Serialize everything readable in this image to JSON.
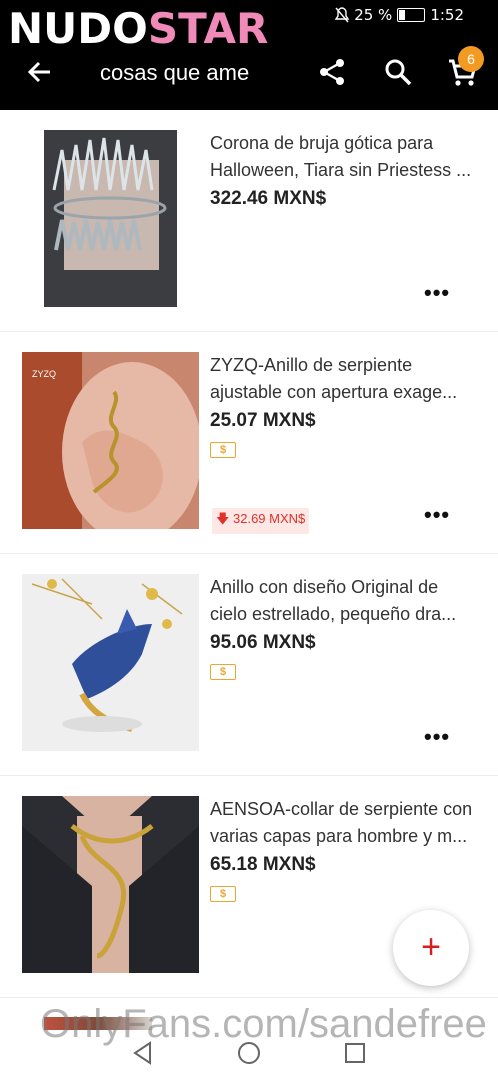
{
  "status_bar": {
    "battery": "25 %",
    "time": "1:52"
  },
  "watermark_logo": {
    "part1": "NUDO",
    "part2": "STAR"
  },
  "header": {
    "title": "cosas que ame",
    "cart_count": "6"
  },
  "items": [
    {
      "name_line1": "Corona de bruja gótica para",
      "name_line2": "Halloween, Tiara sin Priestess ...",
      "price": "322.46 MXN$",
      "has_tag": false,
      "old_price": ""
    },
    {
      "name_line1": "ZYZQ-Anillo de serpiente",
      "name_line2": "ajustable con apertura exage...",
      "price": "25.07 MXN$",
      "has_tag": true,
      "old_price": "32.69 MXN$"
    },
    {
      "name_line1": "Anillo con diseño Original de",
      "name_line2": "cielo estrellado, pequeño dra...",
      "price": "95.06 MXN$",
      "has_tag": true,
      "old_price": ""
    },
    {
      "name_line1": "AENSOA-collar de serpiente con",
      "name_line2": "varias capas para hombre y m...",
      "price": "65.18 MXN$",
      "has_tag": true,
      "old_price": ""
    }
  ],
  "tag_symbol": "$",
  "more_label": "•••",
  "fab_label": "+",
  "footer_watermark": "OnlyFans.com/sandefree",
  "colors": {
    "accent": "#d81e1e",
    "badge": "#f39a23",
    "logo_pink": "#f08ab8"
  }
}
